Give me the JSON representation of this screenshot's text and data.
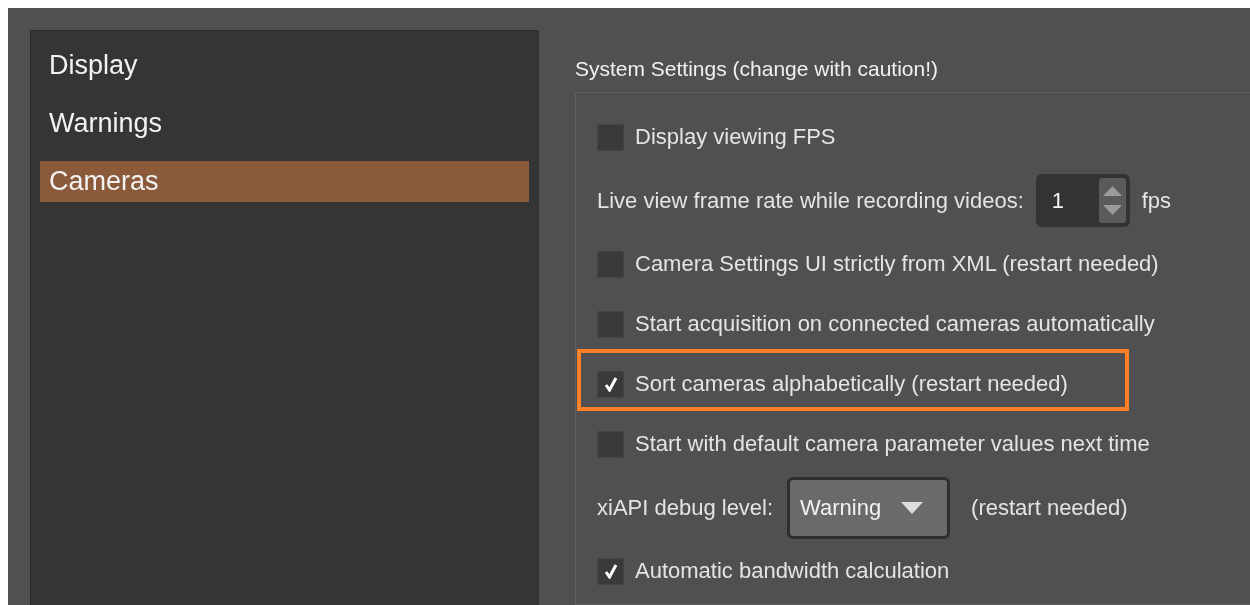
{
  "sidebar": {
    "items": [
      {
        "label": "Display",
        "selected": false
      },
      {
        "label": "Warnings",
        "selected": false
      },
      {
        "label": "Cameras",
        "selected": true
      }
    ]
  },
  "settings": {
    "title": "System Settings (change with caution!)",
    "rows": [
      {
        "kind": "checkbox",
        "label": "Display viewing FPS",
        "checked": false,
        "highlighted": false
      },
      {
        "kind": "spin",
        "label": "Live view frame rate while recording videos:",
        "value": "1",
        "unit": "fps"
      },
      {
        "kind": "checkbox",
        "label": "Camera Settings UI strictly from XML (restart needed)",
        "checked": false,
        "highlighted": false
      },
      {
        "kind": "checkbox",
        "label": "Start acquisition on connected cameras automatically",
        "checked": false,
        "highlighted": false
      },
      {
        "kind": "checkbox",
        "label": "Sort cameras alphabetically (restart needed)",
        "checked": true,
        "highlighted": true
      },
      {
        "kind": "checkbox",
        "label": "Start with default camera parameter values next time",
        "checked": false,
        "highlighted": false
      },
      {
        "kind": "combo",
        "label": "xiAPI debug level:",
        "value": "Warning",
        "note": "(restart needed)"
      },
      {
        "kind": "checkbox",
        "label": "Automatic bandwidth calculation",
        "checked": true,
        "highlighted": false
      }
    ]
  }
}
